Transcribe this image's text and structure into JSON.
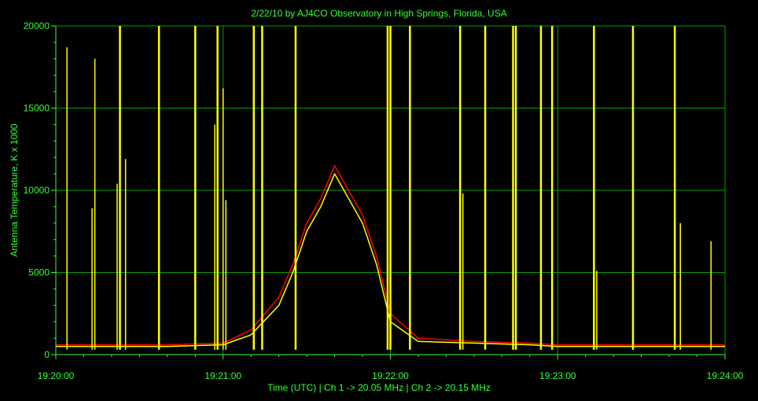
{
  "chart_data": {
    "type": "line",
    "title": "2/22/10  by  AJ4CO Observatory  in  High Springs, Florida, USA",
    "xlabel": "Time (UTC)  |  Ch 1 -> 20.05 MHz  |  Ch 2 -> 20.15 MHz",
    "ylabel": "Antenna Temperature, K x 1000",
    "xlim": [
      "19:20:00",
      "19:24:00"
    ],
    "ylim": [
      0,
      20000
    ],
    "x_ticks": [
      "19:20:00",
      "19:21:00",
      "19:22:00",
      "19:23:00",
      "19:24:00"
    ],
    "y_ticks": [
      "0",
      "5000",
      "10000",
      "15000",
      "20000"
    ],
    "grid": true,
    "colors": {
      "background": "#000000",
      "grid": "#00a000",
      "axis": "#33ff33",
      "text": "#33ff33",
      "ch1": "#ff0000",
      "ch2": "#ffff00"
    },
    "series": [
      {
        "color": "#ff0000",
        "x": [
          "19:20:00",
          "19:20:20",
          "19:20:40",
          "19:21:00",
          "19:21:10",
          "19:21:20",
          "19:21:25",
          "19:21:30",
          "19:21:35",
          "19:21:40",
          "19:21:45",
          "19:21:50",
          "19:21:55",
          "19:22:00",
          "19:22:10",
          "19:22:30",
          "19:22:50",
          "19:23:00",
          "19:23:30",
          "19:24:00"
        ],
        "y": [
          600,
          600,
          600,
          700,
          1500,
          3500,
          5500,
          8000,
          9500,
          11500,
          10000,
          8500,
          6000,
          2500,
          1000,
          800,
          700,
          600,
          600,
          600
        ]
      },
      {
        "color": "#ffff00",
        "x": [
          "19:20:00",
          "19:20:20",
          "19:20:40",
          "19:21:00",
          "19:21:10",
          "19:21:20",
          "19:21:25",
          "19:21:30",
          "19:21:35",
          "19:21:40",
          "19:21:45",
          "19:21:50",
          "19:21:55",
          "19:22:00",
          "19:22:10",
          "19:22:30",
          "19:22:50",
          "19:23:00",
          "19:23:30",
          "19:24:00"
        ],
        "y": [
          500,
          500,
          500,
          600,
          1200,
          3000,
          5000,
          7500,
          9000,
          11000,
          9500,
          8000,
          5500,
          2000,
          800,
          700,
          600,
          500,
          500,
          500
        ]
      }
    ],
    "spikes": [
      {
        "x": "19:20:04",
        "y": 18700
      },
      {
        "x": "19:20:13",
        "y": 8900
      },
      {
        "x": "19:20:14",
        "y": 18000
      },
      {
        "x": "19:20:22",
        "y": 10400
      },
      {
        "x": "19:20:23",
        "y": 20000
      },
      {
        "x": "19:20:25",
        "y": 11900
      },
      {
        "x": "19:20:37",
        "y": 20000
      },
      {
        "x": "19:20:50",
        "y": 20000
      },
      {
        "x": "19:20:57",
        "y": 14000
      },
      {
        "x": "19:20:58",
        "y": 20000
      },
      {
        "x": "19:21:00",
        "y": 16200
      },
      {
        "x": "19:21:01",
        "y": 9400
      },
      {
        "x": "19:21:11",
        "y": 20000
      },
      {
        "x": "19:21:14",
        "y": 20000
      },
      {
        "x": "19:21:26",
        "y": 20000
      },
      {
        "x": "19:21:59",
        "y": 20000
      },
      {
        "x": "19:22:00",
        "y": 20000
      },
      {
        "x": "19:22:07",
        "y": 20000
      },
      {
        "x": "19:22:25",
        "y": 20000
      },
      {
        "x": "19:22:26",
        "y": 9800
      },
      {
        "x": "19:22:34",
        "y": 20000
      },
      {
        "x": "19:22:44",
        "y": 20000
      },
      {
        "x": "19:22:45",
        "y": 20000
      },
      {
        "x": "19:22:54",
        "y": 20000
      },
      {
        "x": "19:22:58",
        "y": 20000
      },
      {
        "x": "19:23:13",
        "y": 20000
      },
      {
        "x": "19:23:14",
        "y": 5100
      },
      {
        "x": "19:23:27",
        "y": 20000
      },
      {
        "x": "19:23:42",
        "y": 20000
      },
      {
        "x": "19:23:44",
        "y": 8000
      },
      {
        "x": "19:23:55",
        "y": 6900
      }
    ]
  }
}
